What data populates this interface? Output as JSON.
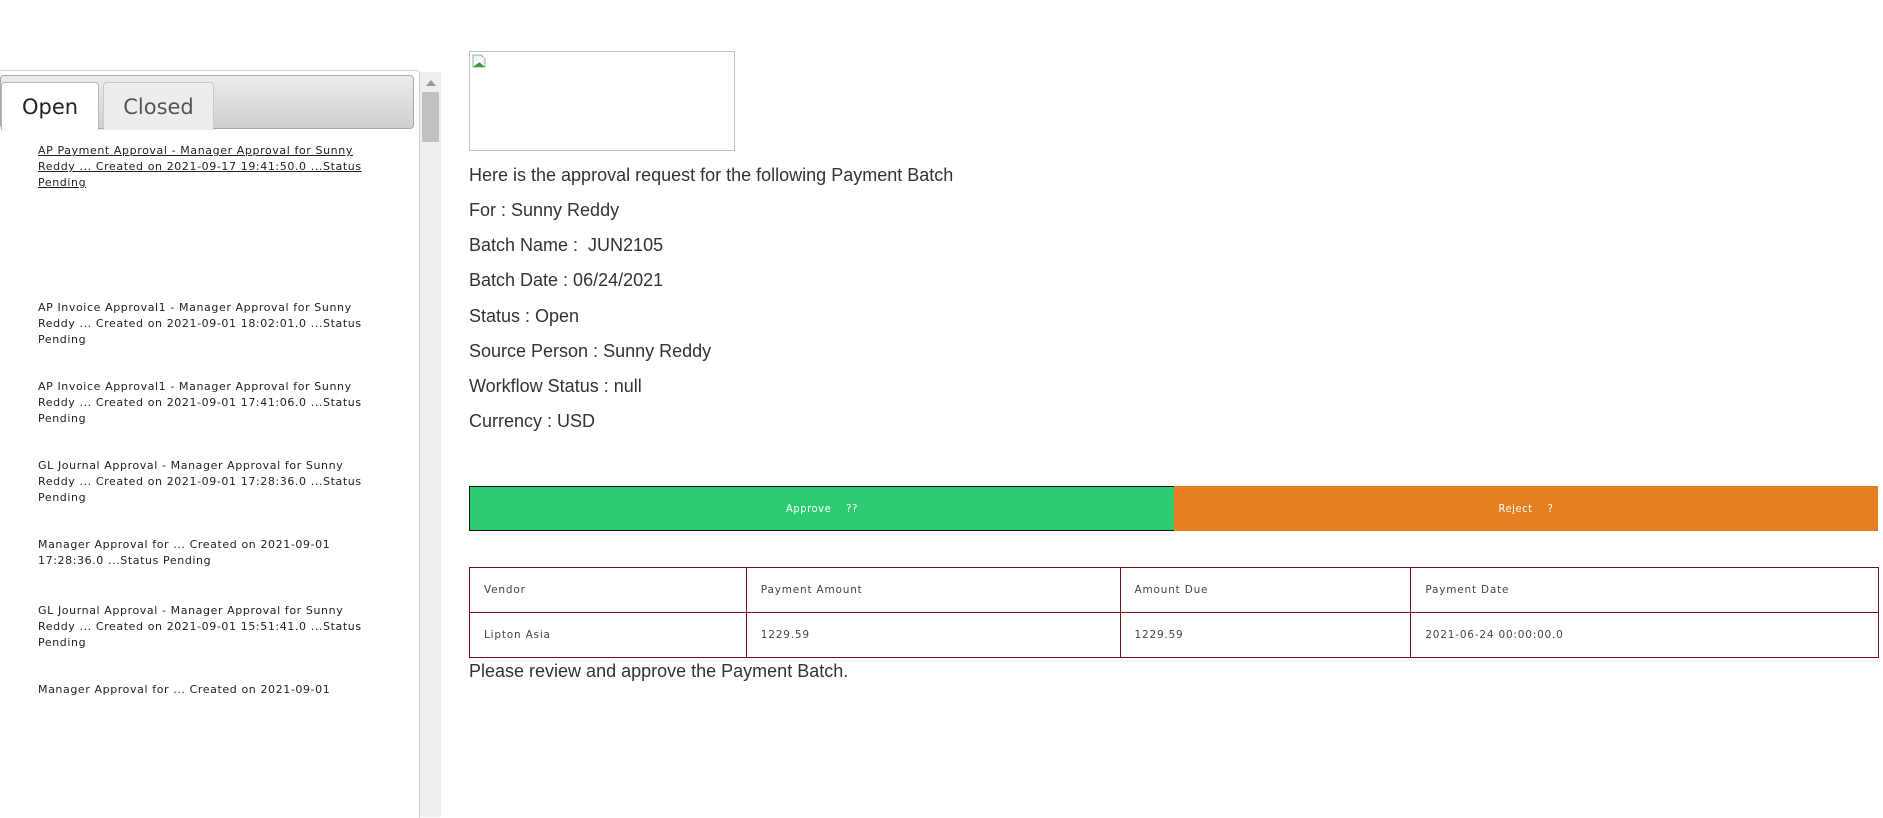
{
  "left_panel": {
    "tabs": [
      {
        "label": "Open",
        "active": true
      },
      {
        "label": "Closed",
        "active": false
      }
    ],
    "items": [
      {
        "text": "AP Payment Approval - Manager Approval for Sunny Reddy ... Created on 2021-09-17 19:41:50.0 ...Status Pending",
        "selected": true
      },
      {
        "text": "AP Invoice Approval1 - Manager Approval for Sunny Reddy ... Created on 2021-09-01 18:02:01.0 ...Status Pending",
        "selected": false
      },
      {
        "text": "AP Invoice Approval1 - Manager Approval for Sunny Reddy ... Created on 2021-09-01 17:41:06.0 ...Status Pending",
        "selected": false
      },
      {
        "text": "GL Journal Approval - Manager Approval for Sunny Reddy ... Created on 2021-09-01 17:28:36.0 ...Status Pending",
        "selected": false
      },
      {
        "text": "Manager Approval for ... Created on 2021-09-01 17:28:36.0 ...Status Pending",
        "selected": false
      },
      {
        "text": "GL Journal Approval - Manager Approval for Sunny Reddy ... Created on 2021-09-01 15:51:41.0 ...Status Pending",
        "selected": false
      },
      {
        "text": "Manager Approval for ... Created on 2021-09-01",
        "selected": false
      }
    ]
  },
  "main": {
    "image_icon": "broken-image-icon",
    "intro": "Here is the approval request for the following Payment Batch",
    "details": [
      "For : Sunny Reddy",
      "Batch Name :  JUN2105",
      "Batch Date : 06/24/2021",
      "Status : Open",
      "Source Person : Sunny Reddy",
      "Workflow Status : null",
      "Currency : USD"
    ],
    "buttons": {
      "approve": "Approve    ??",
      "reject": "Reject    ?"
    },
    "colors": {
      "approve": "#2ecc71",
      "reject": "#e67e22",
      "table_border": "#7b0f0f"
    },
    "table": {
      "headers": [
        "Vendor",
        "Payment Amount",
        "Amount Due",
        "Payment Date"
      ],
      "rows": [
        [
          "Lipton Asia",
          "1229.59",
          "1229.59",
          "2021-06-24 00:00:00.0"
        ]
      ]
    },
    "closing": "Please review and approve the Payment Batch."
  }
}
